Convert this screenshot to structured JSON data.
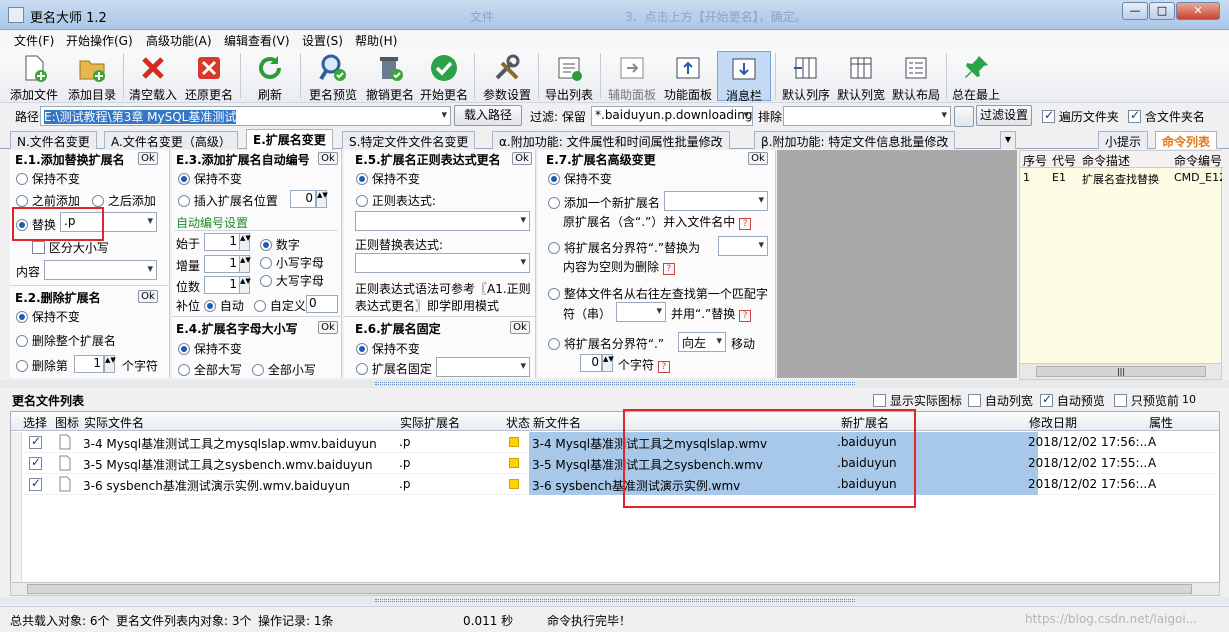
{
  "window": {
    "title": "更名大师 1.2",
    "ghost1": "文件",
    "ghost2": "3、点击上方【开始更名】，确定。",
    "min": "—",
    "max": "□",
    "close": "✕"
  },
  "menu": [
    "文件(F)",
    "开始操作(G)",
    "高级功能(A)",
    "编辑查看(V)",
    "设置(S)",
    "帮助(H)"
  ],
  "toolbar": [
    {
      "label": "添加文件",
      "icon": "add-file-icon"
    },
    {
      "label": "添加目录",
      "icon": "add-folder-icon"
    },
    {
      "label": "清空载入",
      "icon": "clear-icon"
    },
    {
      "label": "还原更名",
      "icon": "restore-icon"
    },
    {
      "label": "刷新",
      "icon": "refresh-icon"
    },
    {
      "label": "更名预览",
      "icon": "preview-icon"
    },
    {
      "label": "撤销更名",
      "icon": "undo-icon"
    },
    {
      "label": "开始更名",
      "icon": "start-icon"
    },
    {
      "label": "参数设置",
      "icon": "settings-icon"
    },
    {
      "label": "导出列表",
      "icon": "export-icon"
    },
    {
      "label": "辅助面板",
      "icon": "aux-panel-icon"
    },
    {
      "label": "功能面板",
      "icon": "func-panel-icon"
    },
    {
      "label": "消息栏",
      "icon": "message-icon"
    },
    {
      "label": "默认列序",
      "icon": "col-order-icon"
    },
    {
      "label": "默认列宽",
      "icon": "col-width-icon"
    },
    {
      "label": "默认布局",
      "icon": "layout-icon"
    },
    {
      "label": "总在最上",
      "icon": "pin-icon"
    }
  ],
  "pathbar": {
    "label": "路径",
    "path": "E:\\测试教程\\第3章 MySQL基准测试",
    "load_btn": "载入路径",
    "filter_label": "过滤: 保留",
    "filter_value": "*.baiduyun.p.downloading",
    "exclude_label": "排除",
    "filter_btn": "过滤设置",
    "traverse": "遍历文件夹",
    "include_folder": "含文件夹名"
  },
  "tabs": [
    "N.文件名变更",
    "A.文件名变更（高级）",
    "E.扩展名变更",
    "S.特定文件文件名变更",
    "α.附加功能: 文件属性和时间属性批量修改",
    "β.附加功能: 特定文件信息批量修改",
    "小提示",
    "命令列表"
  ],
  "e1": {
    "title": "E.1.添加替换扩展名",
    "ok": "Ok",
    "keep": "保持不变",
    "before": "之前添加",
    "after": "之后添加",
    "replace": "替换",
    "replace_value": ".p",
    "case": "区分大小写",
    "content": "内容"
  },
  "e2": {
    "title": "E.2.删除扩展名",
    "ok": "Ok",
    "keep": "保持不变",
    "delete_all": "删除整个扩展名",
    "delete_nth": "删除第",
    "n": "1",
    "chars": "个字符"
  },
  "e3": {
    "title": "E.3.添加扩展名自动编号",
    "ok": "Ok",
    "keep": "保持不变",
    "insert": "插入扩展名位置",
    "insert_pos": "0",
    "auto_title": "自动编号设置",
    "start": "始于",
    "start_v": "1",
    "inc": "增量",
    "inc_v": "1",
    "digits": "位数",
    "digits_v": "1",
    "numeric": "数字",
    "lower": "小写字母",
    "upper": "大写字母",
    "pad": "补位",
    "auto": "自动",
    "custom": "自定义",
    "custom_v": "0"
  },
  "e4": {
    "title": "E.4.扩展名字母大小写",
    "ok": "Ok",
    "keep": "保持不变",
    "all_upper": "全部大写",
    "all_lower": "全部小写"
  },
  "e5": {
    "title": "E.5.扩展名正则表达式更名",
    "ok": "Ok",
    "keep": "保持不变",
    "regex": "正则表达式:",
    "replace_regex": "正则替换表达式:",
    "note1": "正则表达式语法可参考〖A1.正则",
    "note2": "表达式更名〗即学即用模式"
  },
  "e6": {
    "title": "E.6.扩展名固定",
    "ok": "Ok",
    "keep": "保持不变",
    "fixed": "扩展名固定"
  },
  "e7": {
    "title": "E.7.扩展名高级变更",
    "ok": "Ok",
    "keep": "保持不变",
    "add_new": "添加一个新扩展名",
    "orig_in": "原扩展名（含“.”）并入文件名中",
    "split_replace": "将扩展名分界符“.”替换为",
    "empty_delete": "内容为空则为删除",
    "whole_find": "整体文件名从右往左查找第一个匹配字",
    "char_str": "符（串）",
    "and_replace": "并用“.”替换",
    "split_move": "将扩展名分界符“.”",
    "dir": "向左",
    "move": "移动",
    "move_n": "0",
    "move_chars": "个字符"
  },
  "cmdlist": {
    "headers": [
      "序号",
      "代号",
      "命令描述",
      "命令编号"
    ],
    "rows": [
      [
        "1",
        "E1",
        "扩展名查找替换",
        "CMD_E12"
      ]
    ]
  },
  "filelist": {
    "title": "更名文件列表",
    "show_icon": "显示实际图标",
    "auto_width": "自动列宽",
    "auto_preview": "自动预览",
    "preview_first": "只预览前",
    "preview_n": "10",
    "headers": [
      "选择",
      "图标",
      "实际文件名",
      "实际扩展名",
      "状态",
      "新文件名",
      "新扩展名",
      "修改日期",
      "属性"
    ],
    "rows": [
      {
        "name": "3-4 Mysql基准测试工具之mysqlslap.wmv.baiduyun",
        "ext": ".p",
        "new_name": "3-4 Mysql基准测试工具之mysqlslap.wmv",
        "new_ext": ".baiduyun",
        "date": "2018/12/02 17:56:...",
        "attr": "A"
      },
      {
        "name": "3-5 Mysql基准测试工具之sysbench.wmv.baiduyun",
        "ext": ".p",
        "new_name": "3-5 Mysql基准测试工具之sysbench.wmv",
        "new_ext": ".baiduyun",
        "date": "2018/12/02 17:55:...",
        "attr": "A"
      },
      {
        "name": "3-6 sysbench基准测试演示实例.wmv.baiduyun",
        "ext": ".p",
        "new_name": "3-6 sysbench基准测试演示实例.wmv",
        "new_ext": ".baiduyun",
        "date": "2018/12/02 17:56:...",
        "attr": "A"
      }
    ]
  },
  "status": {
    "total": "总共载入对象: 6个",
    "in_list": "更名文件列表内对象: 3个",
    "ops": "操作记录: 1条",
    "time": "0.011 秒",
    "msg": "命令执行完毕！",
    "watermark": "https://blog.csdn.net/laigoi..."
  },
  "colors": {
    "selection": "#a8c8ea",
    "accent": "#e07a16",
    "highlight_box": "#e0262a"
  }
}
